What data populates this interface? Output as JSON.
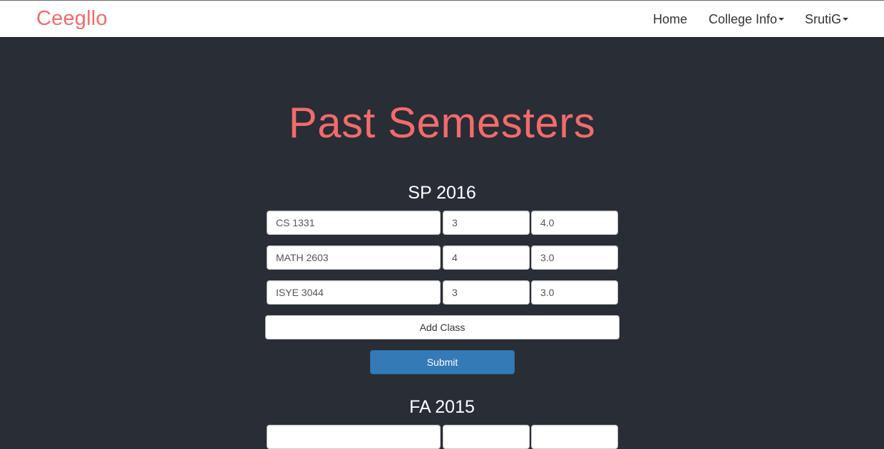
{
  "navbar": {
    "brand": "Ceegllo",
    "items": [
      {
        "label": "Home",
        "dropdown": false
      },
      {
        "label": "College Info",
        "dropdown": true
      },
      {
        "label": "SrutiG",
        "dropdown": true
      }
    ]
  },
  "main": {
    "title": "Past Semesters",
    "semesters": [
      {
        "name": "SP 2016",
        "classes": [
          {
            "course": "CS 1331",
            "credits": "3",
            "grade": "4.0"
          },
          {
            "course": "MATH 2603",
            "credits": "4",
            "grade": "3.0"
          },
          {
            "course": "ISYE 3044",
            "credits": "3",
            "grade": "3.0"
          }
        ],
        "add_class_label": "Add Class",
        "submit_label": "Submit"
      },
      {
        "name": "FA 2015"
      }
    ]
  },
  "colors": {
    "accent": "#f26b6b",
    "background": "#282d36",
    "primary_button": "#337ab7"
  }
}
